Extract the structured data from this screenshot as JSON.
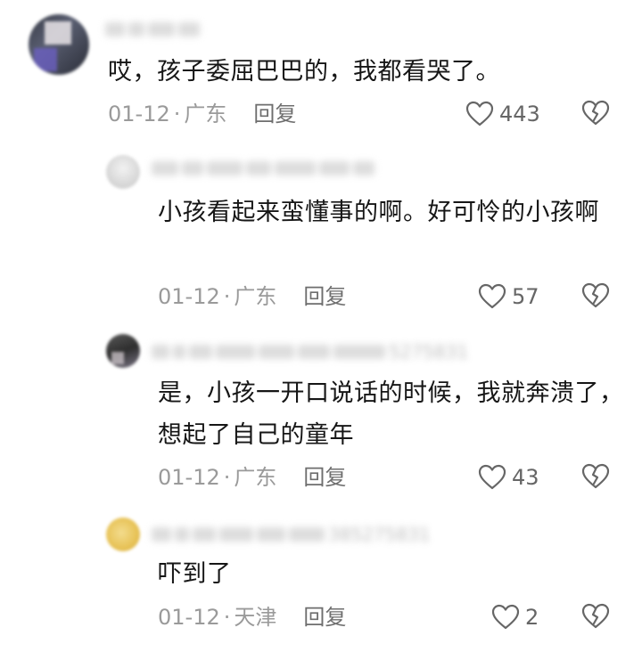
{
  "comments": [
    {
      "text": "哎，孩子委屈巴巴的，我都看哭了。",
      "date": "01-12",
      "location": "广东",
      "reply_label": "回复",
      "likes": "443"
    },
    {
      "text": "小孩看起来蛮懂事的啊。好可怜的小孩啊",
      "date": "01-12",
      "location": "广东",
      "reply_label": "回复",
      "likes": "57"
    },
    {
      "username_fragment": "5275831",
      "text": "是，小孩一开口说话的时候，我就奔溃了，想起了自己的童年",
      "date": "01-12",
      "location": "广东",
      "reply_label": "回复",
      "likes": "43"
    },
    {
      "username_fragment": "385275831",
      "text": "吓到了",
      "date": "01-12",
      "location": "天津",
      "reply_label": "回复",
      "likes": "2"
    }
  ],
  "meta_separator": "·",
  "colors": {
    "text": "#161616",
    "meta": "#9a9a9a",
    "reply": "#6e6e6e",
    "icon": "#666666"
  },
  "icons": {
    "like": "heart-outline-icon",
    "dislike": "broken-heart-icon"
  }
}
